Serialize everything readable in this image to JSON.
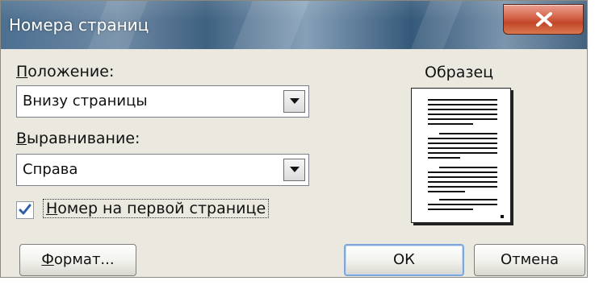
{
  "window": {
    "title": "Номера страниц",
    "close_label": "x"
  },
  "position": {
    "label_accel": "П",
    "label_rest": "оложение:",
    "selected": "Внизу страницы"
  },
  "alignment": {
    "label_accel": "В",
    "label_rest": "ыравнивание:",
    "selected": "Справа"
  },
  "first_page": {
    "checked": true,
    "label_accel": "Н",
    "label_rest": "омер на первой странице"
  },
  "preview": {
    "label": "Образец"
  },
  "buttons": {
    "format_accel": "Ф",
    "format_rest": "ормат...",
    "ok": "ОК",
    "cancel": "Отмена"
  },
  "colors": {
    "dialog_bg": "#eae8df",
    "close_button": "#c24729",
    "checkmark": "#2e5ea8",
    "default_button_border": "#7fa6d8"
  }
}
